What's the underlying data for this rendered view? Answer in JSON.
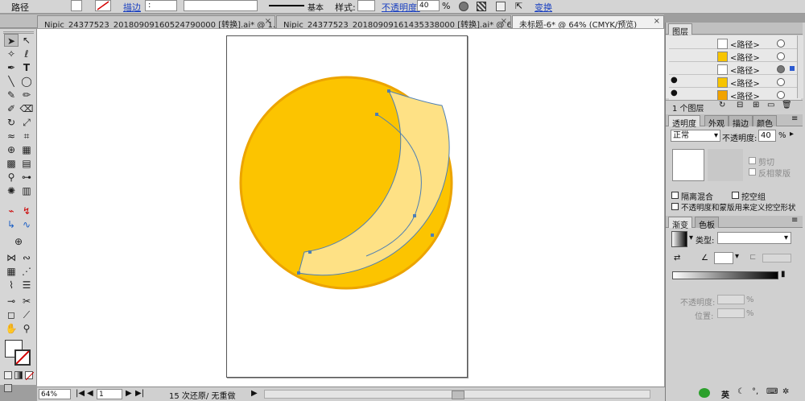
{
  "control_bar": {
    "object_type": "路径",
    "stroke_label": "描边",
    "stroke_stepper": ":",
    "profile_label": "基本",
    "style_label": "样式:",
    "opacity_label": "不透明度:",
    "opacity_value": "40",
    "opacity_unit": "%",
    "transform_label": "变换"
  },
  "tabs": [
    {
      "label": "Nipic_24377523_20180909160524790000 [转换].ai* @ 1..."
    },
    {
      "label": "Nipic_24377523_20180909161435338000 [转换].ai* @ 6..."
    },
    {
      "label": "未标题-6* @ 64% (CMYK/预览)"
    }
  ],
  "tab_close": "×",
  "status_bar": {
    "zoom": "64%",
    "page": "1",
    "message": "15 次还原/ 无重做"
  },
  "layers_panel": {
    "title": "图层",
    "rows": [
      {
        "name": "<路径>",
        "thumb": "#ffffff",
        "eye": ""
      },
      {
        "name": "<路径>",
        "thumb": "#f7c400",
        "eye": ""
      },
      {
        "name": "<路径>",
        "thumb": "#ffffff",
        "eye": ""
      },
      {
        "name": "<路径>",
        "thumb": "#f7c400",
        "eye": "●"
      },
      {
        "name": "<路径>",
        "thumb": "#f1a300",
        "eye": "●"
      }
    ],
    "footer": "1 个图层"
  },
  "transparency_panel": {
    "tabs": [
      "透明度",
      "外观",
      "描边",
      "颜色"
    ],
    "blend_mode": "正常",
    "opacity_label": "不透明度:",
    "opacity_value": "40",
    "opacity_unit": "%",
    "clip_label": "剪切",
    "invert_mask_label": "反相蒙版",
    "isolate_blend_label": "隔离混合",
    "knockout_group_label": "挖空组",
    "opacity_mask_label": "不透明度和蒙版用来定义挖空形状"
  },
  "gradient_panel": {
    "tabs": [
      "渐变",
      "色板"
    ],
    "type_label": "类型:",
    "opacity_label": "不透明度:",
    "location_label": "位置:",
    "unit": "%"
  },
  "tray": {
    "ime": "英"
  },
  "colors": {
    "circle_fill": "#fcc400",
    "circle_stroke": "#eca400",
    "arc_fill": "#fee185",
    "path_select": "#4d7fb5"
  }
}
